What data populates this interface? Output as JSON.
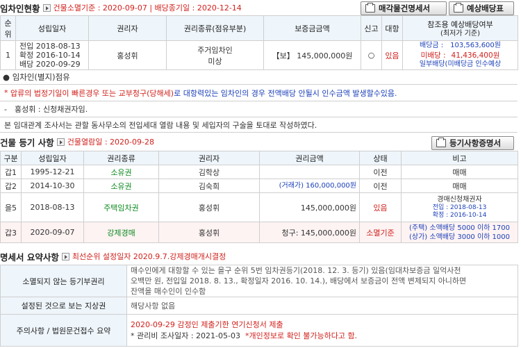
{
  "tenant": {
    "title": "임차인현황",
    "meta": "건물소멸기준 : 2020-09-07 | 배당종기일 : 2020-12-14",
    "btn_appraisal": "매각물건명세서",
    "btn_dividend": "예상배당표",
    "headers": {
      "no1": "순",
      "no2": "위",
      "date": "성립일자",
      "holder": "권리자",
      "type": "권리종류(점유부분)",
      "deposit": "보증금금액",
      "report": "신고",
      "oppose": "대항",
      "ref1": "참조용 예상배당여부",
      "ref2": "(최저가 기준)"
    },
    "row": {
      "no": "1",
      "date1": "전입 2018-08-13",
      "date2": "확정 2016-10-14",
      "date3": "배당 2020-09-29",
      "holder": "홍성휘",
      "type1": "주거임차인",
      "type2": "미상",
      "deposit": "【보】 145,000,000원",
      "report": "○",
      "oppose": "있음",
      "div_label": "배당금 :",
      "div_value": "103,563,600원",
      "undiv_label": "미배당 :",
      "undiv_value": "41,436,400원",
      "partial": "일부배당(미배당금 인수예상"
    },
    "note_occupy": "● 임차인(별지)점유",
    "note_warning_star": "*",
    "note_warning_red": "압류의 법정기일이 빠른경우 또는 교부청구(당해세)",
    "note_warning_blue": "로 대항력있는 임차인의 경우 전액배당 안될시 인수금액 발생할수있음.",
    "note_applicant": "-　홍성휘 : 신청채권자임.",
    "note_survey": "본 임대관계 조사서는 관할 동사무소의 전입세대 열람 내용 및 세입자의 구술을 토대로 작성하였다."
  },
  "registry": {
    "title": "건물 등기 사항",
    "meta": "건물열람일 : 2020-09-28",
    "btn": "등기사항증명서",
    "headers": {
      "kind": "구분",
      "date": "성립일자",
      "type": "권리종류",
      "holder": "권리자",
      "amount": "권리금액",
      "status": "상태",
      "remark": "비고"
    },
    "rows": [
      {
        "kind": "갑1",
        "date": "1995-12-21",
        "type": "소유권",
        "holder": "김학상",
        "amount": "",
        "status": "이전",
        "remark": "매매"
      },
      {
        "kind": "갑2",
        "date": "2014-10-30",
        "type": "소유권",
        "holder": "김숙희",
        "amount": "(거래가) 160,000,000원",
        "status": "이전",
        "remark": "매매"
      },
      {
        "kind": "을5",
        "date": "2018-08-13",
        "type": "주택임차권",
        "holder": "홍성휘",
        "amount": "145,000,000원",
        "status": "있음",
        "remark1": "경매신청채권자",
        "remark2": "전입 : 2018-08-13",
        "remark3": "확정 : 2016-10-14"
      },
      {
        "kind": "갑3",
        "date": "2020-09-07",
        "type": "강제경매",
        "holder": "홍성휘",
        "amount": "청구: 145,000,000원",
        "status": "소멸기준",
        "remark1": "(주택) 소액배당 5000 이하 1700",
        "remark2": "(상가) 소액배당 3000 이하 1000"
      }
    ]
  },
  "summary": {
    "title": "명세서 요약사항",
    "meta": "최선순위 설정일자 2020.9.7.강제경매개시결정",
    "row1_label": "소멸되지 않는 등기부권리",
    "row1_l1": "매수인에게 대항할 수 있는 을구 순위 5번 임차권등기(2018. 12. 3. 등기) 있음(임대차보증금 일억사천",
    "row1_l2": "오백만 원, 전입일 2018. 8. 13., 확정일자 2016. 10. 14.), 배당에서 보증금이 전액 변제되지 아니하면",
    "row1_l3": "잔액을 매수인이 인수함",
    "row2_label": "설정된 것으로 보는 지상권",
    "row2_value": "해당사항 없음",
    "row3_label": "주의사항 / 법원문건접수 요약",
    "row3_l1": "2020-09-29 감정인 제출기한 연기신청서 제출",
    "row3_l2a": "* 관리비 조사일자 : 2021-05-03",
    "row3_l2b": "*개인정보로 확인 불가능하다고 함."
  },
  "colors": {
    "accent_red": "#d0211c",
    "header_bg": "#eef5fb",
    "link_blue": "#1a3fb8",
    "green": "#0b8a1e"
  }
}
